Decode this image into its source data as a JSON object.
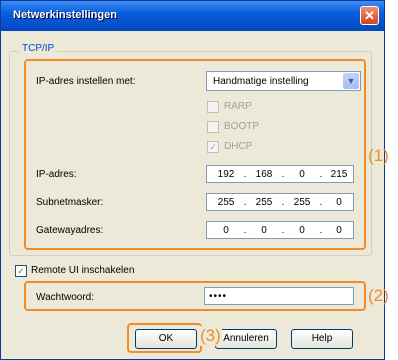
{
  "window": {
    "title": "Netwerkinstellingen",
    "close": "✕"
  },
  "group": {
    "label": "TCP/IP"
  },
  "ip_assign": {
    "label": "IP-adres instellen met:",
    "value": "Handmatige instelling"
  },
  "options": [
    {
      "label": "RARP",
      "checked": false
    },
    {
      "label": "BOOTP",
      "checked": false
    },
    {
      "label": "DHCP",
      "checked": true
    }
  ],
  "fields": {
    "ip": {
      "label": "IP-adres:",
      "octets": [
        "192",
        "168",
        "0",
        "215"
      ]
    },
    "subnet": {
      "label": "Subnetmasker:",
      "octets": [
        "255",
        "255",
        "255",
        "0"
      ]
    },
    "gateway": {
      "label": "Gatewayadres:",
      "octets": [
        "0",
        "0",
        "0",
        "0"
      ]
    }
  },
  "remote_ui": {
    "label": "Remote UI inschakelen",
    "checked": true
  },
  "password": {
    "label": "Wachtwoord:",
    "value": "••••"
  },
  "buttons": {
    "ok": "OK",
    "cancel": "Annuleren",
    "help": "Help"
  },
  "callouts": [
    "(1)",
    "(2)",
    "(3)"
  ],
  "colors": {
    "highlight": "#f28c28",
    "titlebar": "#0a5fdc",
    "link": "#0046d5"
  }
}
